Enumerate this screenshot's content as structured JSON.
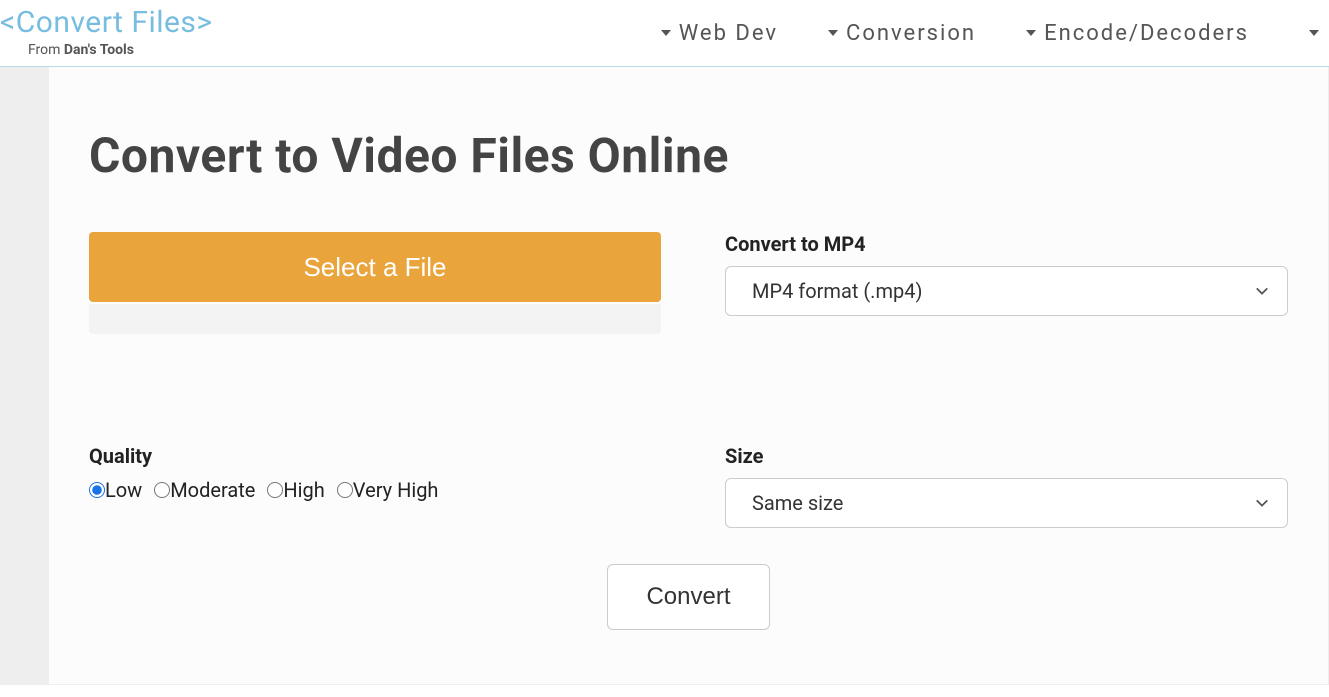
{
  "header": {
    "logo_text": "<Convert Files>",
    "logo_sub_from": "From ",
    "logo_sub_brand": "Dan's Tools",
    "nav": [
      {
        "label": "Web Dev"
      },
      {
        "label": "Conversion"
      },
      {
        "label": "Encode/Decoders"
      }
    ]
  },
  "main": {
    "title": "Convert to Video Files Online",
    "select_file_label": "Select a File",
    "format_label": "Convert to MP4",
    "format_value": "MP4 format (.mp4)",
    "quality_label": "Quality",
    "quality_options": [
      "Low",
      "Moderate",
      "High",
      "Very High"
    ],
    "quality_selected": "Low",
    "size_label": "Size",
    "size_value": "Same size",
    "convert_label": "Convert"
  }
}
